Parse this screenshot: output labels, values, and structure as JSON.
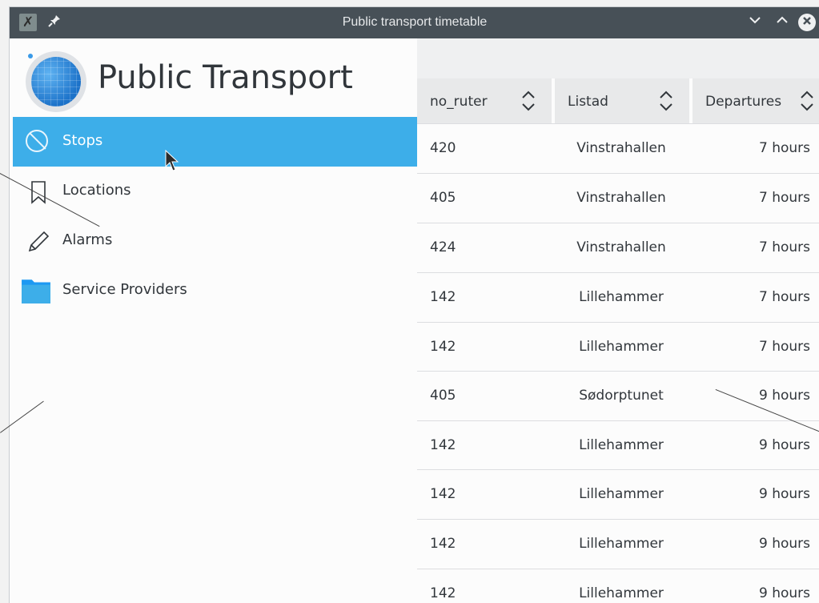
{
  "window": {
    "title": "Public transport timetable",
    "app_icon_glyph": "✗",
    "pin_glyph": "✎",
    "min_glyph": "⌄",
    "max_glyph": "⌃",
    "close_glyph": "✕"
  },
  "sidebar": {
    "app_title": "Public Transport",
    "items": [
      {
        "label": "Stops",
        "icon": "stop-icon",
        "active": true
      },
      {
        "label": "Locations",
        "icon": "bookmark-icon",
        "active": false
      },
      {
        "label": "Alarms",
        "icon": "pencil-icon",
        "active": false
      },
      {
        "label": "Service Providers",
        "icon": "folder-icon",
        "active": false
      }
    ]
  },
  "table": {
    "columns": [
      "no_ruter",
      "Listad",
      "Departures"
    ],
    "rows": [
      [
        "420",
        "Vinstrahallen",
        "7 hours"
      ],
      [
        "405",
        "Vinstrahallen",
        "7 hours"
      ],
      [
        "424",
        "Vinstrahallen",
        "7 hours"
      ],
      [
        "142",
        "Lillehammer",
        "7 hours"
      ],
      [
        "142",
        "Lillehammer",
        "7 hours"
      ],
      [
        "405",
        "Sødorptunet",
        "9 hours"
      ],
      [
        "142",
        "Lillehammer",
        "9 hours"
      ],
      [
        "142",
        "Lillehammer",
        "9 hours"
      ],
      [
        "142",
        "Lillehammer",
        "9 hours"
      ],
      [
        "142",
        "Lillehammer",
        "9 hours"
      ]
    ]
  },
  "colors": {
    "accent": "#3daee9",
    "titlebar": "#475057",
    "text": "#31363b"
  }
}
